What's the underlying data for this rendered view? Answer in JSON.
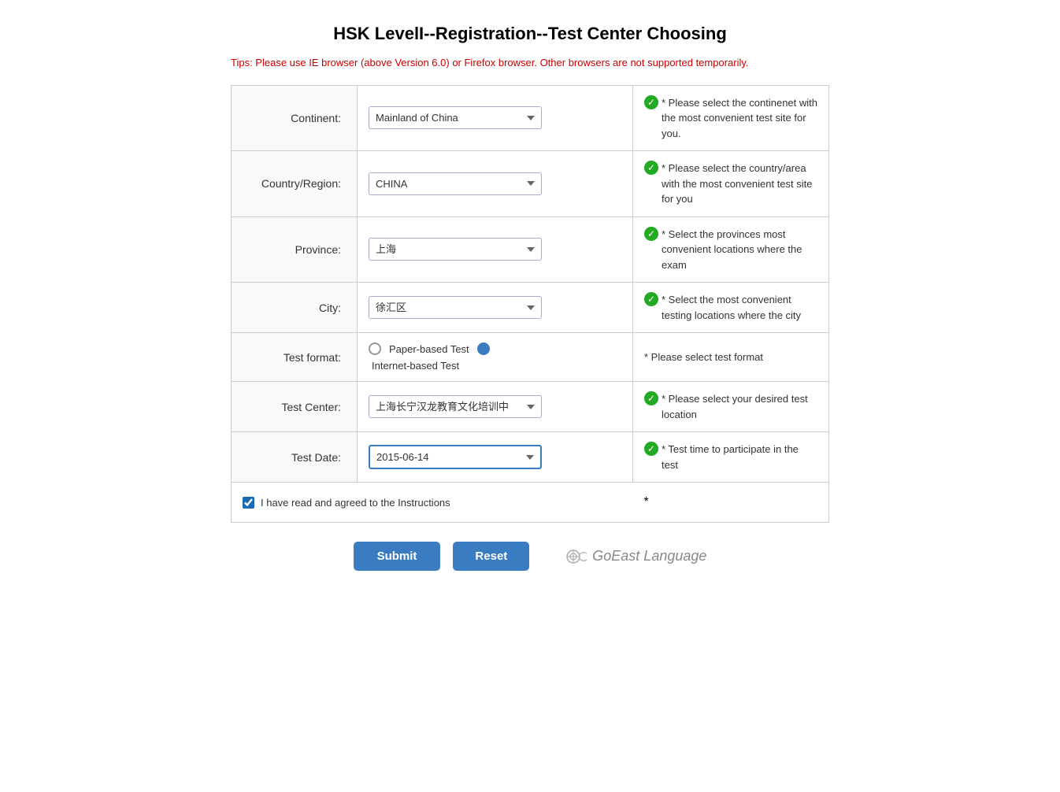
{
  "page": {
    "title": "HSK LevelI--Registration--Test Center Choosing",
    "tips": "Tips: Please use IE browser (above Version 6.0) or Firefox browser. Other browsers are not supported temporarily."
  },
  "form": {
    "continent_label": "Continent:",
    "continent_value": "Mainland of China",
    "continent_hint": "* Please select the continenet with the most convenient test site for you.",
    "country_label": "Country/Region:",
    "country_value": "CHINA",
    "country_hint": "* Please select the country/area with the most convenient test site for you",
    "province_label": "Province:",
    "province_value": "上海",
    "province_hint": "* Select the provinces most convenient locations where the exam",
    "city_label": "City:",
    "city_value": "徐汇区",
    "city_hint": "* Select the most convenient testing locations where the city",
    "testformat_label": "Test format:",
    "testformat_paper": "Paper-based Test",
    "testformat_internet": "Internet-based Test",
    "testformat_hint": "* Please select test format",
    "testcenter_label": "Test Center:",
    "testcenter_value": "上海长宁汉龙教育文化培训中",
    "testcenter_hint": "* Please select your desired test location",
    "testdate_label": "Test Date:",
    "testdate_value": "2015-06-14",
    "testdate_hint": "* Test time to participate in the test",
    "agree_label": "I have read and agreed to the Instructions",
    "agree_asterisk": "*",
    "submit_label": "Submit",
    "reset_label": "Reset",
    "brand_name": "GoEast Language"
  }
}
